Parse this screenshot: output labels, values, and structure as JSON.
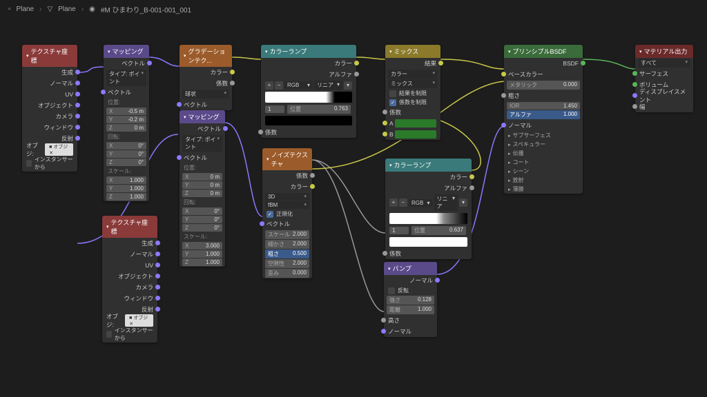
{
  "breadcrumb": {
    "a": "Plane",
    "b": "Plane",
    "c": "#M ひまわり_B-001-001_001"
  },
  "texcoord": {
    "title": "テクスチャ座標",
    "outputs": [
      "生成",
      "ノーマル",
      "UV",
      "オブジェクト",
      "カメラ",
      "ウィンドウ",
      "反射"
    ],
    "obj": "オブジ:",
    "from": "インスタンサーから"
  },
  "mapping": {
    "title": "マッピング",
    "vector": "ベクトル",
    "type_lbl": "タイプ:",
    "type": "ポイント",
    "vec": "ベクトル",
    "loc": "位置:",
    "rot": "回転:",
    "scale": "スケール:",
    "loc_vals": [
      "-0.5 m",
      "-0.2 m",
      "0 m"
    ],
    "rot_vals": [
      "0°",
      "0°",
      "0°"
    ],
    "scale_vals": [
      "1.000",
      "1.000",
      "1.000"
    ],
    "axes": [
      "X",
      "Y",
      "Z"
    ]
  },
  "mapping2": {
    "loc_vals": [
      "0 m",
      "0 m",
      "0 m"
    ],
    "rot_vals": [
      "0°",
      "0°",
      "0°"
    ],
    "scale_vals": [
      "3.000",
      "1.000",
      "1.000"
    ]
  },
  "gradient": {
    "title": "グラデーションテク...",
    "color": "カラー",
    "fac": "係数",
    "type": "球状",
    "vec": "ベクトル"
  },
  "ramp": {
    "title": "カラーランプ",
    "color": "カラー",
    "alpha": "アルファ",
    "rgb": "RGB",
    "linear": "リニア",
    "idx": "1",
    "pos_lbl": "位置",
    "pos": "0.763",
    "fac": "係数"
  },
  "ramp2": {
    "pos": "0.637"
  },
  "mix": {
    "title": "ミックス",
    "result": "結果",
    "color": "カラー",
    "mix": "ミックス",
    "clamp_r": "結果を制限",
    "clamp_f": "係数を制限",
    "fac": "係数",
    "a": "A",
    "b": "B"
  },
  "noise": {
    "title": "ノイズテクスチャ",
    "fac": "係数",
    "color": "カラー",
    "dim": "3D",
    "type": "fBM",
    "normalize": "正規化",
    "vec": "ベクトル",
    "scale": "スケール",
    "scale_v": "2.000",
    "detail": "細かさ",
    "detail_v": "2.000",
    "rough": "粗さ",
    "rough_v": "0.500",
    "lac": "空隙性",
    "lac_v": "2.000",
    "dist": "歪み",
    "dist_v": "0.000"
  },
  "bump": {
    "title": "バンプ",
    "normal": "ノーマル",
    "invert": "反転",
    "strength": "強さ",
    "strength_v": "0.128",
    "dist": "距離",
    "dist_v": "1.000",
    "height": "高さ",
    "normal_in": "ノーマル"
  },
  "bsdf": {
    "title": "プリンシプルBSDF",
    "out": "BSDF",
    "base": "ベースカラー",
    "metallic": "メタリック",
    "metallic_v": "0.000",
    "rough": "粗さ",
    "ior": "IOR",
    "ior_v": "1.450",
    "alpha": "アルファ",
    "alpha_v": "1.000",
    "normal": "ノーマル",
    "subs": [
      "サブサーフェス",
      "スペキュラー",
      "伝播",
      "コート",
      "シーン",
      "放射",
      "薄膜"
    ]
  },
  "output": {
    "title": "マテリアル出力",
    "all": "すべて",
    "surface": "サーフェス",
    "volume": "ボリューム",
    "disp": "ディスプレイスメント",
    "thick": "幅"
  }
}
